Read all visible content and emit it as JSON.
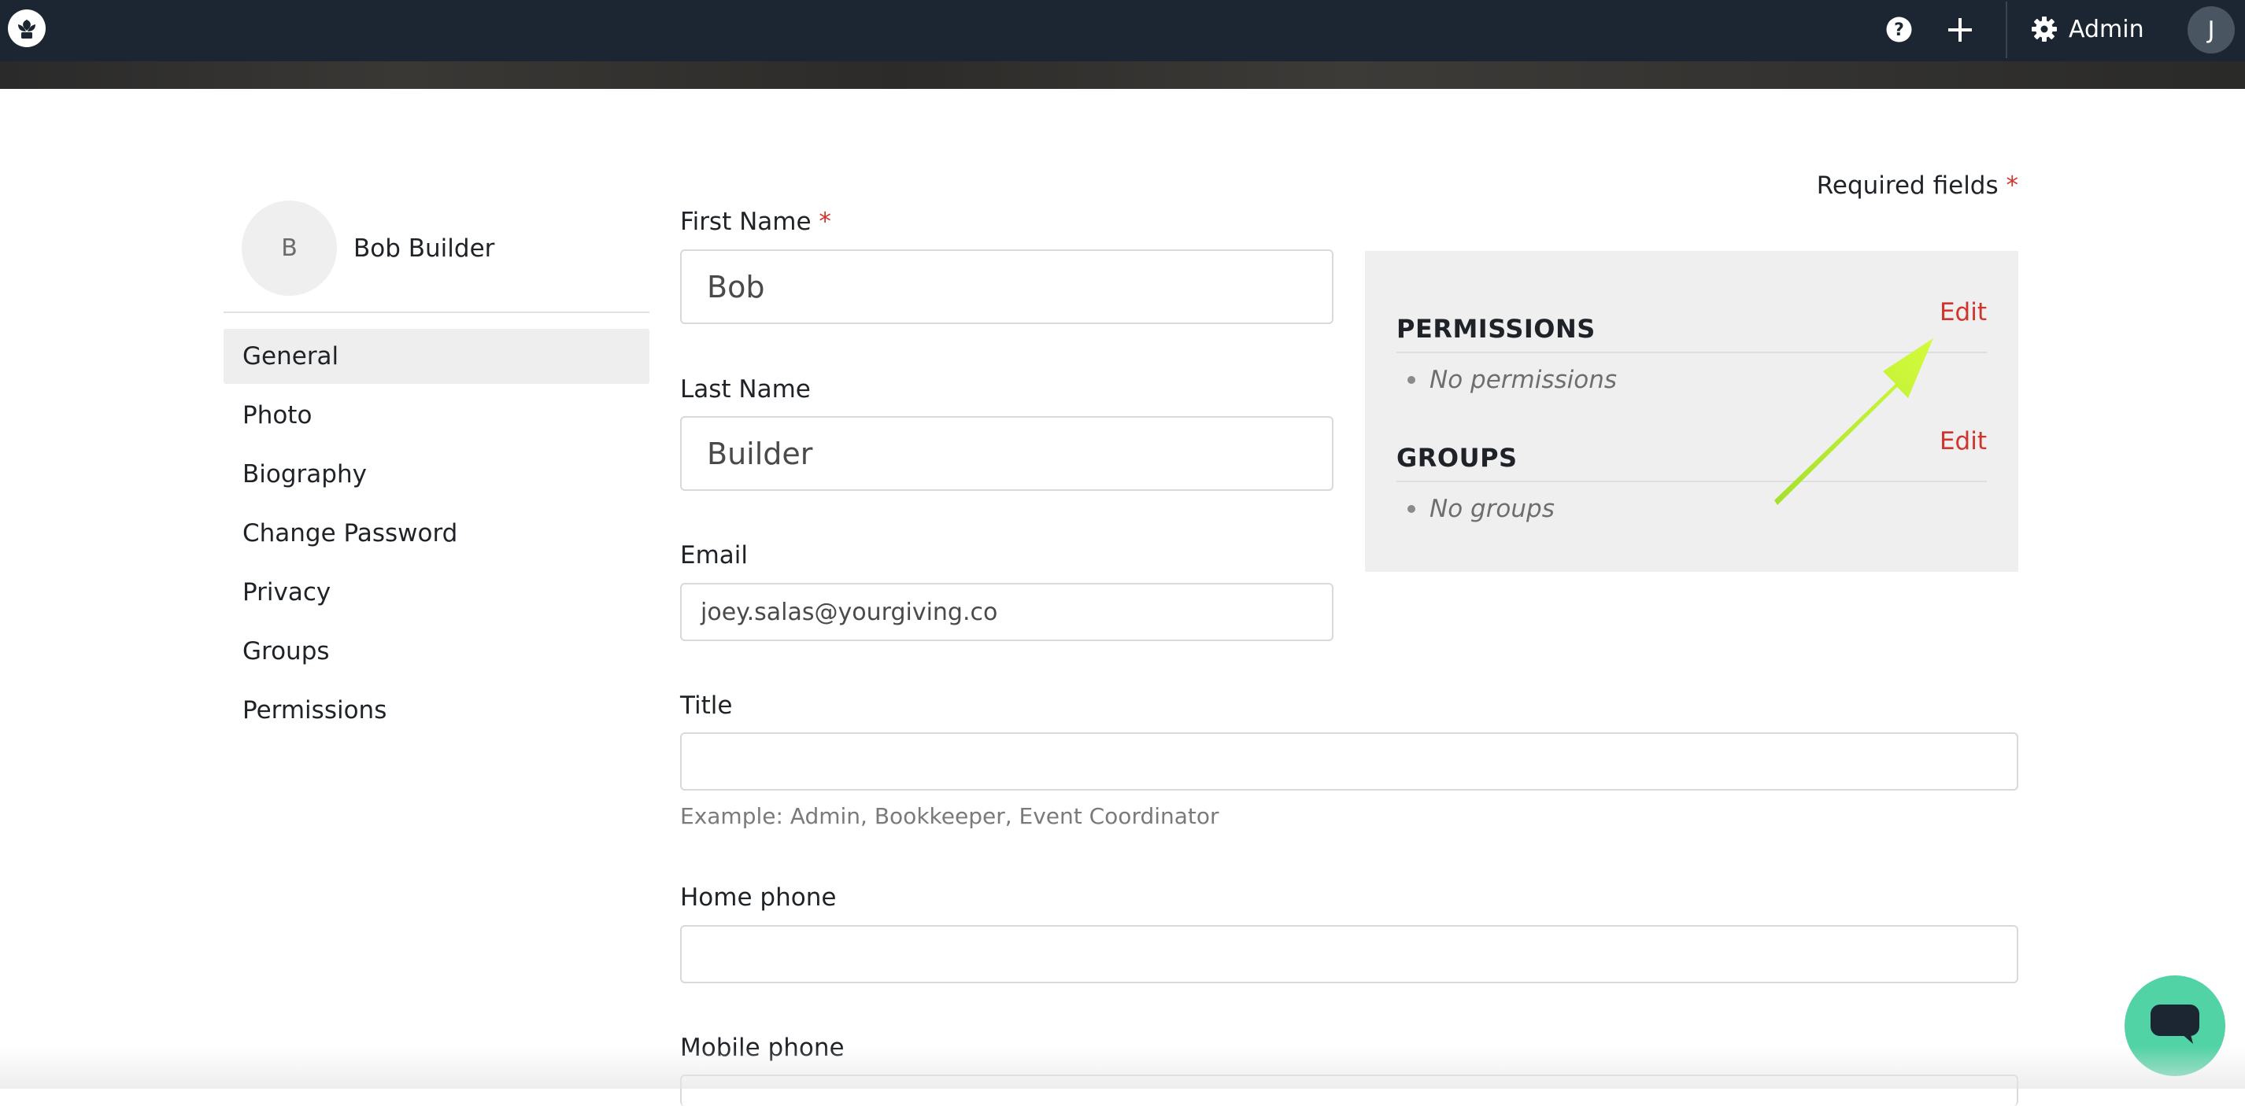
{
  "topbar": {
    "logo_icon": "leaf-logo-icon",
    "help_icon": "question-circle-icon",
    "add_icon": "plus-icon",
    "settings_icon": "gear-icon",
    "admin_label": "Admin",
    "user_initial": "J"
  },
  "sidebar": {
    "avatar_initial": "B",
    "user_name": "Bob Builder",
    "items": [
      {
        "label": "General",
        "active": true
      },
      {
        "label": "Photo",
        "active": false
      },
      {
        "label": "Biography",
        "active": false
      },
      {
        "label": "Change Password",
        "active": false
      },
      {
        "label": "Privacy",
        "active": false
      },
      {
        "label": "Groups",
        "active": false
      },
      {
        "label": "Permissions",
        "active": false
      }
    ]
  },
  "form": {
    "required_note": "Required fields",
    "required_star": "*",
    "first_name_label": "First Name",
    "first_name_value": "Bob",
    "last_name_label": "Last Name",
    "last_name_value": "Builder",
    "email_label": "Email",
    "email_value": "joey.salas@yourgiving.co",
    "title_label": "Title",
    "title_value": "",
    "title_hint": "Example: Admin, Bookkeeper, Event Coordinator",
    "home_phone_label": "Home phone",
    "home_phone_value": "",
    "mobile_phone_label": "Mobile phone"
  },
  "panel": {
    "permissions_title": "PERMISSIONS",
    "permissions_edit": "Edit",
    "permissions_empty": "No permissions",
    "groups_title": "GROUPS",
    "groups_edit": "Edit",
    "groups_empty": "No groups"
  },
  "colors": {
    "topbar": "#1c2633",
    "accent_red": "#d0342c",
    "annotation_arrow": "#c6f43a",
    "chat_button": "#52d3a5"
  },
  "chat": {
    "icon": "chat-bubble-icon"
  }
}
